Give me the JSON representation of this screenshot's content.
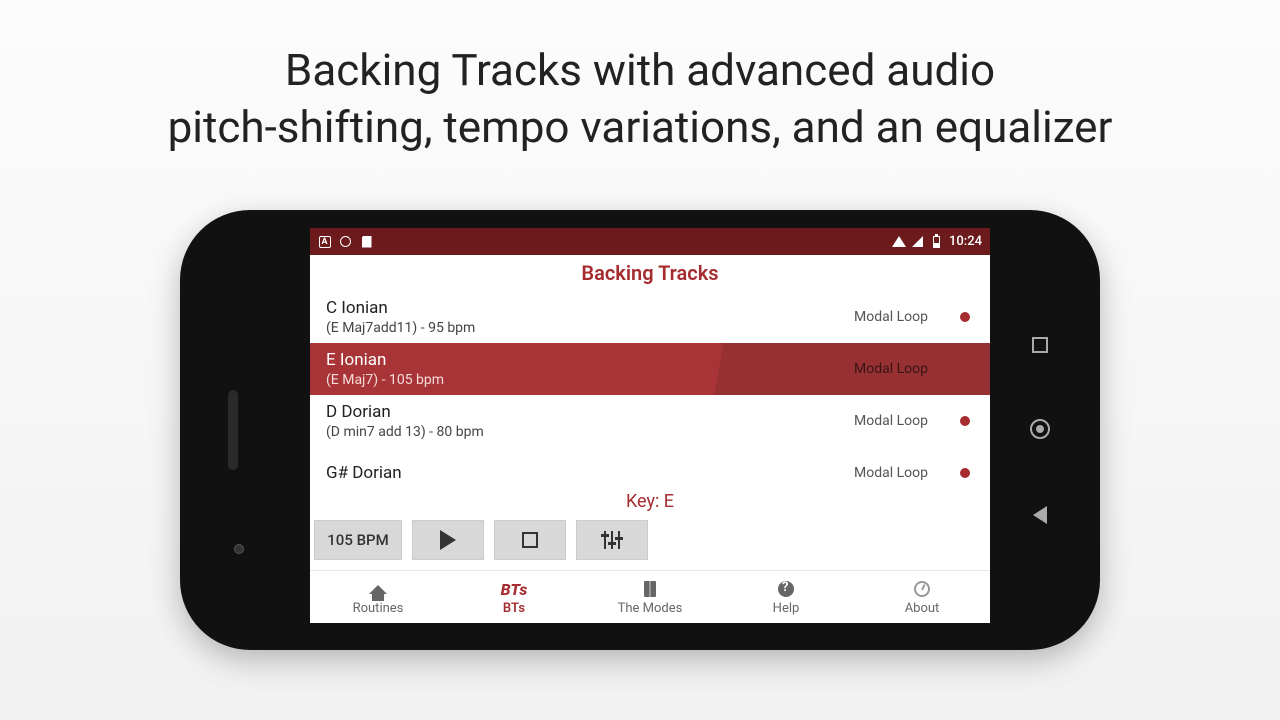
{
  "headline_line1": "Backing Tracks with advanced audio",
  "headline_line2": "pitch-shifting, tempo variations, and an equalizer",
  "status": {
    "time": "10:24"
  },
  "header": {
    "title": "Backing Tracks"
  },
  "tracks": [
    {
      "title": "C Ionian",
      "subtitle": "(E Maj7add11) - 95 bpm",
      "tag": "Modal Loop",
      "selected": false,
      "dot": true
    },
    {
      "title": "E Ionian",
      "subtitle": "(E Maj7) - 105 bpm",
      "tag": "Modal Loop",
      "selected": true,
      "dot": false
    },
    {
      "title": "D Dorian",
      "subtitle": "(D min7 add 13) - 80 bpm",
      "tag": "Modal Loop",
      "selected": false,
      "dot": true
    },
    {
      "title": "G# Dorian",
      "subtitle": "",
      "tag": "Modal Loop",
      "selected": false,
      "dot": true
    }
  ],
  "key_label": "Key: E",
  "controls": {
    "bpm_label": "105 BPM"
  },
  "nav": {
    "routines": "Routines",
    "bts_icon": "BTs",
    "bts": "BTs",
    "modes": "The Modes",
    "help": "Help",
    "about": "About"
  }
}
